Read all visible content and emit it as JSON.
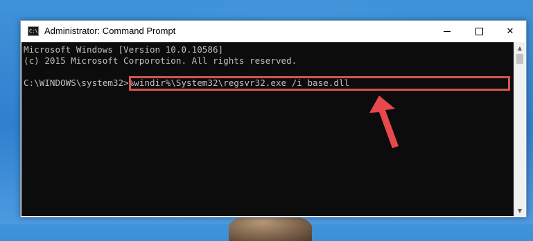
{
  "window": {
    "title": "Administrator: Command Prompt",
    "icon_text": "C:\\",
    "controls": {
      "minimize_icon": "minimize-icon",
      "maximize_icon": "maximize-icon",
      "close_label": "✕"
    }
  },
  "console": {
    "lines": [
      "Microsoft Windows [Version 10.0.10586]",
      "(c) 2015 Microsoft Corporotion. All rights reserved.",
      "",
      "C:\\WINDOWS\\system32>"
    ],
    "command": "%windir%\\System32\\regsvr32.exe /i base.dll"
  },
  "scrollbar": {
    "up_arrow": "▲",
    "down_arrow": "▼"
  },
  "annotation": {
    "highlight_color": "#d9534f",
    "arrow_color": "#e8474c"
  },
  "colors": {
    "console_bg": "#0c0c0c",
    "console_text": "#c0c0c0",
    "desktop_bg": "#2f7fcf"
  }
}
